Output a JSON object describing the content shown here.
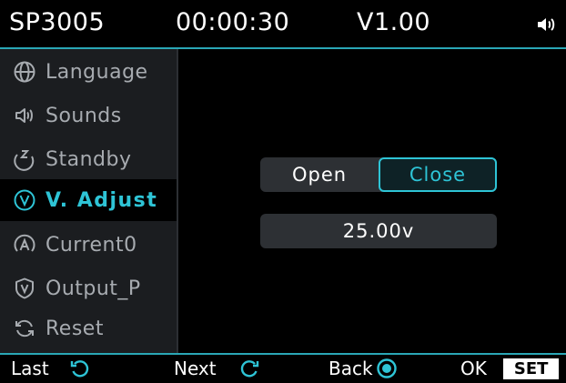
{
  "header": {
    "model": "SP3005",
    "time": "00:00:30",
    "version": "V1.00",
    "volume_icon": "speaker-icon"
  },
  "sidebar": {
    "items": [
      {
        "label": "Language",
        "icon": "globe-icon"
      },
      {
        "label": "Sounds",
        "icon": "speaker-icon"
      },
      {
        "label": "Standby",
        "icon": "standby-icon"
      },
      {
        "label": "V. Adjust",
        "icon": "voltage-icon",
        "active": true
      },
      {
        "label": "Current0",
        "icon": "current-icon"
      },
      {
        "label": "Output_P",
        "icon": "shield-icon"
      },
      {
        "label": "Reset",
        "icon": "reset-icon"
      }
    ]
  },
  "main": {
    "toggle": {
      "open_label": "Open",
      "close_label": "Close",
      "selected": "Close"
    },
    "value": "25.00v"
  },
  "footer": {
    "last": "Last",
    "next": "Next",
    "back": "Back",
    "ok": "OK",
    "set": "SET"
  },
  "colors": {
    "accent": "#2ec4d6",
    "sidebar_bg": "#1b1d20",
    "control_bg": "#2d3034"
  }
}
